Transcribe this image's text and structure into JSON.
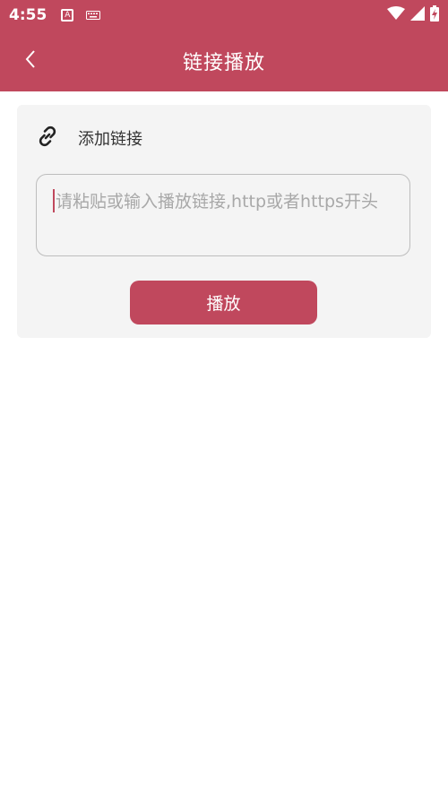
{
  "status_bar": {
    "time": "4:55",
    "notification_letter": "A"
  },
  "app_bar": {
    "title": "链接播放"
  },
  "card": {
    "title": "添加链接",
    "input_placeholder": "请粘贴或输入播放链接,http或者https开头",
    "play_label": "播放"
  },
  "colors": {
    "brand": "#c0485d",
    "card_bg": "#f4f4f4",
    "placeholder": "#a8a8a8"
  },
  "icons": {
    "back": "chevron-left-icon",
    "link": "link-icon",
    "wifi": "wifi-icon",
    "signal": "signal-icon",
    "battery": "battery-charging-icon",
    "keyboard": "keyboard-icon"
  }
}
